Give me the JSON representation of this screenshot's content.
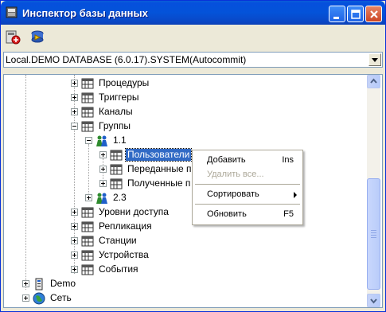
{
  "window": {
    "title": "Инспектор базы данных"
  },
  "connection": {
    "selected": "Local.DEMO DATABASE (6.0.17).SYSTEM(Autocommit)"
  },
  "tree": {
    "items": [
      {
        "label": "Процедуры",
        "icon": "folder-table-icon"
      },
      {
        "label": "Триггеры",
        "icon": "folder-table-icon"
      },
      {
        "label": "Каналы",
        "icon": "folder-table-icon"
      },
      {
        "label": "Группы",
        "icon": "folder-table-icon"
      },
      {
        "label": "1.1",
        "icon": "users-group-icon"
      },
      {
        "label": "Пользователи",
        "icon": "folder-table-icon"
      },
      {
        "label": "Переданные п",
        "icon": "folder-table-icon"
      },
      {
        "label": "Полученные п",
        "icon": "folder-table-icon"
      },
      {
        "label": "2.3",
        "icon": "users-group-icon"
      },
      {
        "label": "Уровни доступа",
        "icon": "folder-table-icon"
      },
      {
        "label": "Репликация",
        "icon": "folder-table-icon"
      },
      {
        "label": "Станции",
        "icon": "folder-table-icon"
      },
      {
        "label": "Устройства",
        "icon": "folder-table-icon"
      },
      {
        "label": "События",
        "icon": "folder-table-icon"
      },
      {
        "label": "Demo",
        "icon": "database-icon"
      },
      {
        "label": "Сеть",
        "icon": "globe-icon"
      }
    ]
  },
  "context_menu": {
    "items": [
      {
        "label": "Добавить",
        "shortcut": "Ins"
      },
      {
        "label": "Удалить все...",
        "shortcut": ""
      },
      {
        "label": "Сортировать",
        "shortcut": ""
      },
      {
        "label": "Обновить",
        "shortcut": "F5"
      }
    ]
  },
  "colors": {
    "title_bar": "#0550dc",
    "selection": "#316ac5",
    "close_button": "#cc4523"
  }
}
